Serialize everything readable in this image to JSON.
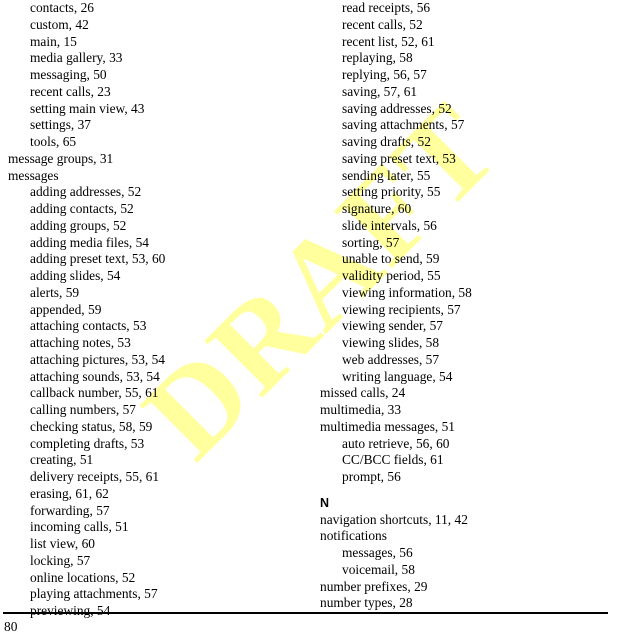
{
  "document": {
    "type": "book-index-page",
    "page_number": "80",
    "watermark": {
      "text": "DRAFT",
      "color": "#ffff9e",
      "rotation_degrees": -45
    }
  },
  "columns": [
    {
      "name": "left-column",
      "entries": [
        {
          "level": 2,
          "text": "contacts, 26"
        },
        {
          "level": 2,
          "text": "custom, 42"
        },
        {
          "level": 2,
          "text": "main, 15"
        },
        {
          "level": 2,
          "text": "media gallery, 33"
        },
        {
          "level": 2,
          "text": "messaging, 50"
        },
        {
          "level": 2,
          "text": "recent calls, 23"
        },
        {
          "level": 2,
          "text": "setting main view, 43"
        },
        {
          "level": 2,
          "text": "settings, 37"
        },
        {
          "level": 2,
          "text": "tools, 65"
        },
        {
          "level": 1,
          "text": "message groups, 31"
        },
        {
          "level": 1,
          "text": "messages"
        },
        {
          "level": 2,
          "text": "adding addresses, 52"
        },
        {
          "level": 2,
          "text": "adding contacts, 52"
        },
        {
          "level": 2,
          "text": "adding groups, 52"
        },
        {
          "level": 2,
          "text": "adding media files, 54"
        },
        {
          "level": 2,
          "text": "adding preset text, 53, 60"
        },
        {
          "level": 2,
          "text": "adding slides, 54"
        },
        {
          "level": 2,
          "text": "alerts, 59"
        },
        {
          "level": 2,
          "text": "appended, 59"
        },
        {
          "level": 2,
          "text": "attaching contacts, 53"
        },
        {
          "level": 2,
          "text": "attaching notes, 53"
        },
        {
          "level": 2,
          "text": "attaching pictures, 53, 54"
        },
        {
          "level": 2,
          "text": "attaching sounds, 53, 54"
        },
        {
          "level": 2,
          "text": "callback number, 55, 61"
        },
        {
          "level": 2,
          "text": "calling numbers, 57"
        },
        {
          "level": 2,
          "text": "checking status, 58, 59"
        },
        {
          "level": 2,
          "text": "completing drafts, 53"
        },
        {
          "level": 2,
          "text": "creating, 51"
        },
        {
          "level": 2,
          "text": "delivery receipts, 55, 61"
        },
        {
          "level": 2,
          "text": "erasing, 61, 62"
        },
        {
          "level": 2,
          "text": "forwarding, 57"
        },
        {
          "level": 2,
          "text": "incoming calls, 51"
        },
        {
          "level": 2,
          "text": "list view, 60"
        },
        {
          "level": 2,
          "text": "locking, 57"
        },
        {
          "level": 2,
          "text": "online locations, 52"
        },
        {
          "level": 2,
          "text": "playing attachments, 57"
        },
        {
          "level": 2,
          "text": "previewing, 54"
        }
      ]
    },
    {
      "name": "right-column",
      "entries": [
        {
          "level": 2,
          "text": "read receipts, 56"
        },
        {
          "level": 2,
          "text": "recent calls, 52"
        },
        {
          "level": 2,
          "text": "recent list, 52, 61"
        },
        {
          "level": 2,
          "text": "replaying, 58"
        },
        {
          "level": 2,
          "text": "replying, 56, 57"
        },
        {
          "level": 2,
          "text": "saving, 57, 61"
        },
        {
          "level": 2,
          "text": "saving addresses, 52"
        },
        {
          "level": 2,
          "text": "saving attachments, 57"
        },
        {
          "level": 2,
          "text": "saving drafts, 52"
        },
        {
          "level": 2,
          "text": "saving preset text, 53"
        },
        {
          "level": 2,
          "text": "sending later, 55"
        },
        {
          "level": 2,
          "text": "setting priority, 55"
        },
        {
          "level": 2,
          "text": "signature, 60"
        },
        {
          "level": 2,
          "text": "slide intervals, 56"
        },
        {
          "level": 2,
          "text": "sorting, 57"
        },
        {
          "level": 2,
          "text": "unable to send, 59"
        },
        {
          "level": 2,
          "text": "validity period, 55"
        },
        {
          "level": 2,
          "text": "viewing information, 58"
        },
        {
          "level": 2,
          "text": "viewing recipients, 57"
        },
        {
          "level": 2,
          "text": "viewing sender, 57"
        },
        {
          "level": 2,
          "text": "viewing slides, 58"
        },
        {
          "level": 2,
          "text": "web addresses, 57"
        },
        {
          "level": 2,
          "text": "writing language, 54"
        },
        {
          "level": 1,
          "text": "missed calls, 24"
        },
        {
          "level": 1,
          "text": "multimedia, 33"
        },
        {
          "level": 1,
          "text": "multimedia messages, 51"
        },
        {
          "level": 2,
          "text": "auto retrieve, 56, 60"
        },
        {
          "level": 2,
          "text": "CC/BCC fields, 61"
        },
        {
          "level": 2,
          "text": "prompt, 56"
        },
        {
          "level": "head",
          "text": "N"
        },
        {
          "level": 1,
          "text": "navigation shortcuts, 11, 42"
        },
        {
          "level": 1,
          "text": "notifications"
        },
        {
          "level": 2,
          "text": "messages, 56"
        },
        {
          "level": 2,
          "text": "voicemail, 58"
        },
        {
          "level": 1,
          "text": "number prefixes, 29"
        },
        {
          "level": 1,
          "text": "number types, 28"
        }
      ]
    }
  ]
}
